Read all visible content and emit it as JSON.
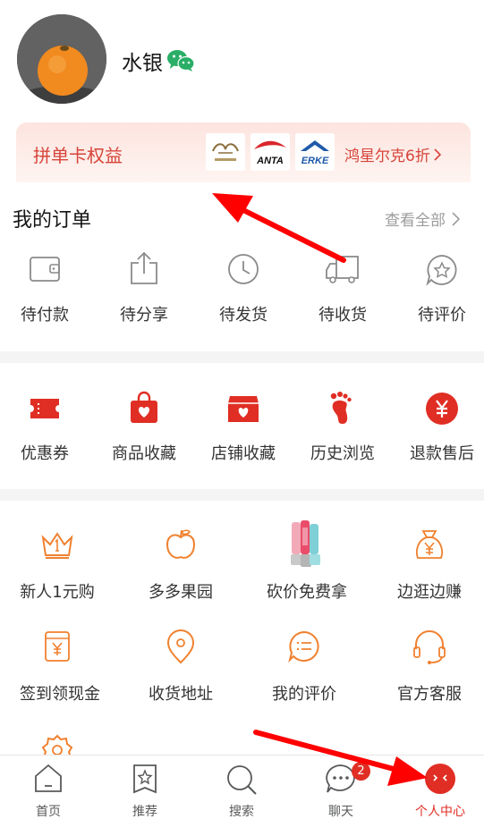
{
  "profile": {
    "username": "水银"
  },
  "banner": {
    "title": "拼单卡权益",
    "brands": [
      "",
      "ANTA",
      "ERKE"
    ],
    "promo": "鸿星尔克6折"
  },
  "orders": {
    "title": "我的订单",
    "view_all": "查看全部",
    "items": [
      {
        "label": "待付款",
        "icon": "wallet-icon"
      },
      {
        "label": "待分享",
        "icon": "share-icon"
      },
      {
        "label": "待发货",
        "icon": "clock-icon"
      },
      {
        "label": "待收货",
        "icon": "truck-icon"
      },
      {
        "label": "待评价",
        "icon": "star-comment-icon"
      }
    ]
  },
  "favorites": {
    "items": [
      {
        "label": "优惠券",
        "icon": "coupon-icon"
      },
      {
        "label": "商品收藏",
        "icon": "bag-heart-icon"
      },
      {
        "label": "店铺收藏",
        "icon": "store-heart-icon"
      },
      {
        "label": "历史浏览",
        "icon": "footprint-icon"
      },
      {
        "label": "退款售后",
        "icon": "refund-icon"
      }
    ]
  },
  "services": {
    "items": [
      {
        "label": "新人1元购",
        "icon": "crown-icon"
      },
      {
        "label": "多多果园",
        "icon": "apple-icon"
      },
      {
        "label": "砍价免费拿",
        "icon": "juicer-icon"
      },
      {
        "label": "边逛边赚",
        "icon": "money-bag-icon"
      },
      {
        "label": "签到领现金",
        "icon": "cash-card-icon"
      },
      {
        "label": "收货地址",
        "icon": "location-icon"
      },
      {
        "label": "我的评价",
        "icon": "comment-icon"
      },
      {
        "label": "官方客服",
        "icon": "headset-icon"
      }
    ]
  },
  "bottom_nav": {
    "items": [
      {
        "label": "首页",
        "icon": "home-icon"
      },
      {
        "label": "推荐",
        "icon": "recommend-icon"
      },
      {
        "label": "搜索",
        "icon": "search-icon"
      },
      {
        "label": "聊天",
        "icon": "chat-icon",
        "badge": "2"
      },
      {
        "label": "个人中心",
        "icon": "profile-icon",
        "active": true
      }
    ]
  },
  "colors": {
    "accent": "#e02e24",
    "banner_text": "#d6443a",
    "service_icon": "#f0812f",
    "annotation_arrow": "#ff0000"
  }
}
